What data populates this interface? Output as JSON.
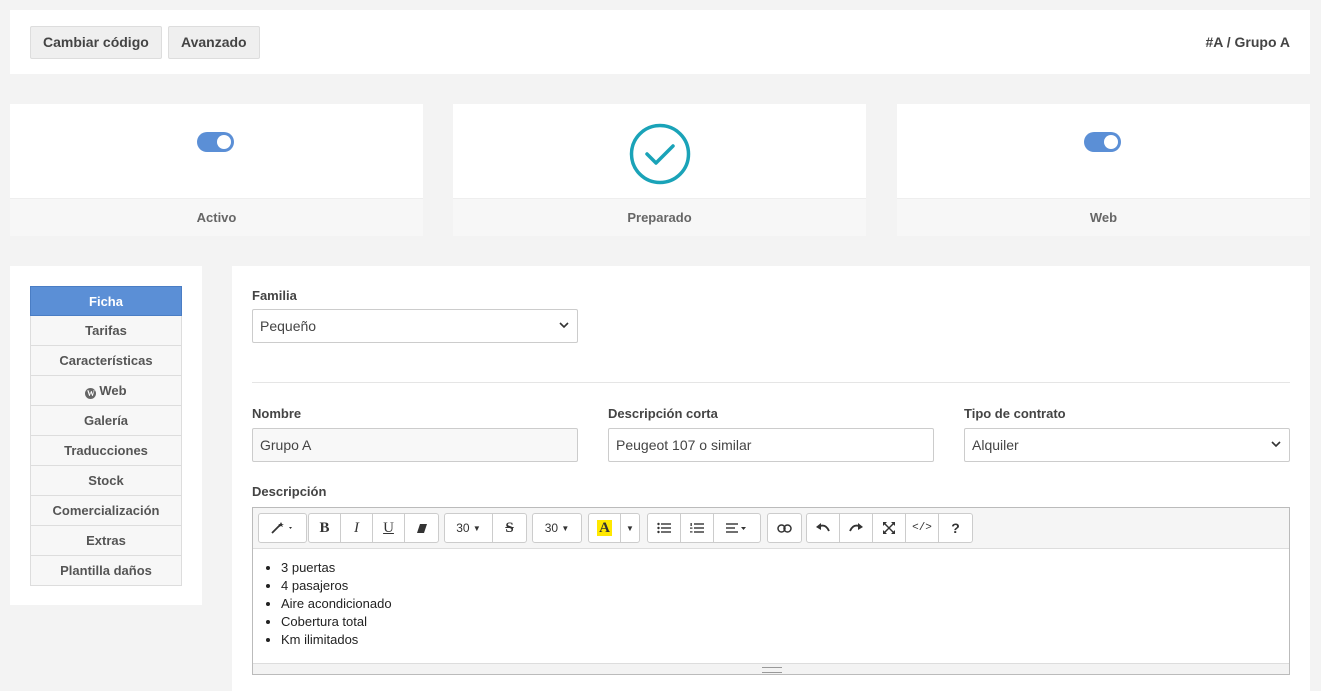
{
  "toolbar": {
    "change_code": "Cambiar código",
    "advanced": "Avanzado",
    "breadcrumb": "#A / Grupo A"
  },
  "cards": [
    {
      "label": "Activo",
      "state": "on"
    },
    {
      "label": "Preparado",
      "state": "checked"
    },
    {
      "label": "Web",
      "state": "on"
    }
  ],
  "sidebar": {
    "items": [
      {
        "label": "Ficha",
        "active": true
      },
      {
        "label": "Tarifas"
      },
      {
        "label": "Características"
      },
      {
        "label": "Web",
        "icon": "wordpress-icon"
      },
      {
        "label": "Galería"
      },
      {
        "label": "Traducciones"
      },
      {
        "label": "Stock"
      },
      {
        "label": "Comercialización"
      },
      {
        "label": "Extras"
      },
      {
        "label": "Plantilla daños"
      }
    ]
  },
  "form": {
    "familia_label": "Familia",
    "familia_value": "Pequeño",
    "nombre_label": "Nombre",
    "nombre_value": "Grupo A",
    "desc_corta_label": "Descripción corta",
    "desc_corta_value": "Peugeot 107 o similar",
    "tipo_label": "Tipo de contrato",
    "tipo_value": "Alquiler",
    "descripcion_label": "Descripción"
  },
  "editor": {
    "font_size": "30",
    "line_height": "30",
    "content": [
      "3 puertas",
      "4 pasajeros",
      "Aire acondicionado",
      "Cobertura total",
      "Km ilimitados"
    ]
  },
  "colors": {
    "accent": "#5b8fd6",
    "check": "#1aa3b8"
  }
}
